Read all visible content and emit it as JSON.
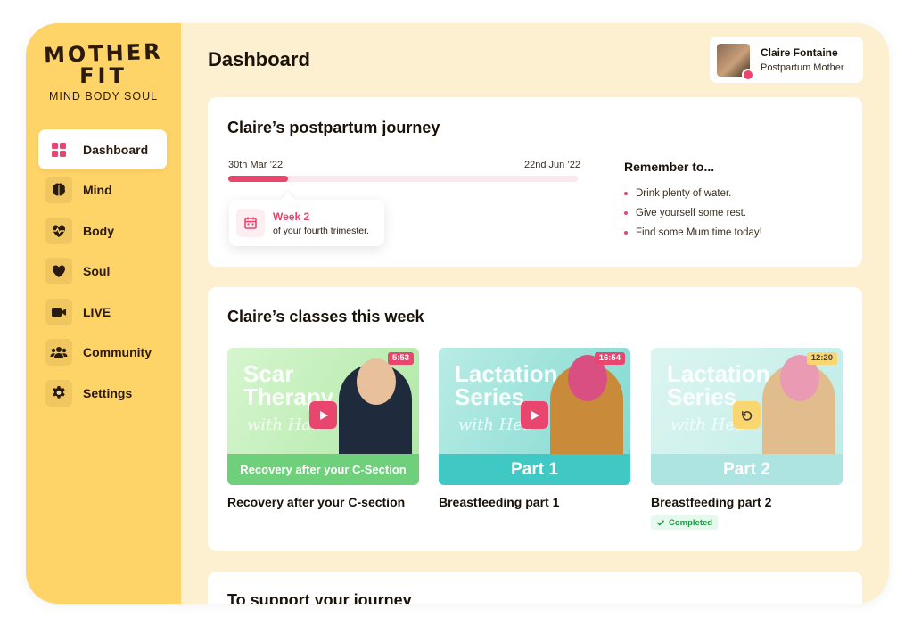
{
  "brand": {
    "name_line1": "MOTHER",
    "name_line2": "FIT",
    "tagline": "MIND BODY SOUL"
  },
  "sidebar": {
    "items": [
      {
        "label": "Dashboard",
        "icon": "dashboard-grid-icon",
        "active": true
      },
      {
        "label": "Mind",
        "icon": "brain-icon"
      },
      {
        "label": "Body",
        "icon": "heart-pulse-icon"
      },
      {
        "label": "Soul",
        "icon": "heart-icon"
      },
      {
        "label": "LIVE",
        "icon": "video-camera-icon"
      },
      {
        "label": "Community",
        "icon": "users-icon"
      },
      {
        "label": "Settings",
        "icon": "gear-icon"
      }
    ]
  },
  "header": {
    "title": "Dashboard"
  },
  "user": {
    "name": "Claire Fontaine",
    "role": "Postpartum Mother"
  },
  "journey": {
    "title": "Claire’s postpartum journey",
    "start_date": "30th Mar ’22",
    "end_date": "22nd Jun ’22",
    "progress": 0.17,
    "week_label": "Week 2",
    "week_sub": "of your fourth trimester.",
    "remember_title": "Remember to...",
    "reminders": [
      "Drink plenty of water.",
      "Give yourself some rest.",
      "Find some Mum time today!"
    ]
  },
  "classes": {
    "title": "Claire’s classes this week",
    "items": [
      {
        "thumb_title_1": "Scar",
        "thumb_title_2": "Therapy",
        "thumb_subtitle": "with Han",
        "banner": "Recovery after your C-Section",
        "duration": "5:53",
        "name": "Recovery after your C-section",
        "status": ""
      },
      {
        "thumb_title_1": "Lactation",
        "thumb_title_2": "Series",
        "thumb_subtitle": "with Hea",
        "banner": "Part 1",
        "duration": "16:54",
        "name": "Breastfeeding part 1",
        "status": ""
      },
      {
        "thumb_title_1": "Lactation",
        "thumb_title_2": "Series",
        "thumb_subtitle": "with Hea",
        "banner": "Part 2",
        "duration": "12:20",
        "name": "Breastfeeding part 2",
        "status": "Completed"
      }
    ]
  },
  "support": {
    "title": "To support your journey"
  },
  "colors": {
    "accent": "#e8466f",
    "sidebar": "#fed367",
    "background": "#fdf0d0",
    "green": "#6ed07a",
    "teal": "#40c9c4",
    "completed": "#1e9b47"
  }
}
